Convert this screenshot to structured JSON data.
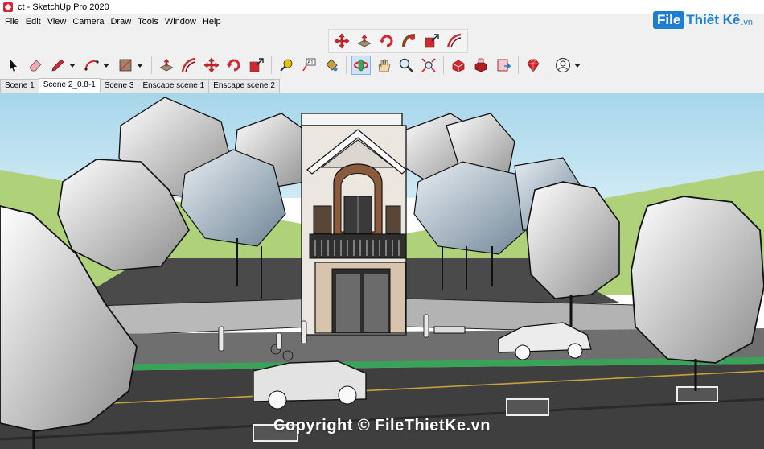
{
  "window": {
    "title": "ct - SketchUp Pro 2020"
  },
  "brand": {
    "logo_file": "File",
    "logo_name": "Thiết Kế",
    "logo_tld": ".vn"
  },
  "menu": [
    "File",
    "Edit",
    "View",
    "Camera",
    "Draw",
    "Tools",
    "Window",
    "Help"
  ],
  "toolbar_top": [
    "move-icon",
    "push-pull-icon",
    "rotate-icon",
    "follow-me-icon",
    "scale-icon",
    "offset-icon"
  ],
  "toolbar_main": [
    "select-icon",
    "eraser-icon",
    "pencil-icon",
    "arc-icon",
    "rectangle-icon",
    "push-pull-icon",
    "offset-icon",
    "move-icon",
    "rotate-icon",
    "scale-icon",
    "tape-measure-icon",
    "text-icon",
    "paint-bucket-icon",
    "orbit-icon",
    "pan-icon",
    "zoom-icon",
    "zoom-extents-icon",
    "3d-warehouse-icon",
    "extension-warehouse-icon",
    "layout-icon",
    "ruby-icon",
    "user-icon"
  ],
  "scenes": [
    "Scene 1",
    "Scene 2_0.8-1",
    "Scene 3",
    "Enscape scene 1",
    "Enscape scene 2"
  ],
  "active_scene": "Scene 2_0.8-1",
  "watermark": "Copyright © FileThietKe.vn",
  "colors": {
    "sky": "#b2dcec",
    "grass": "#aed17a",
    "road": "#3f3f3f",
    "wall": "#b9b9b9",
    "accent_red": "#d8262f",
    "brand_blue": "#1e7fd0"
  }
}
